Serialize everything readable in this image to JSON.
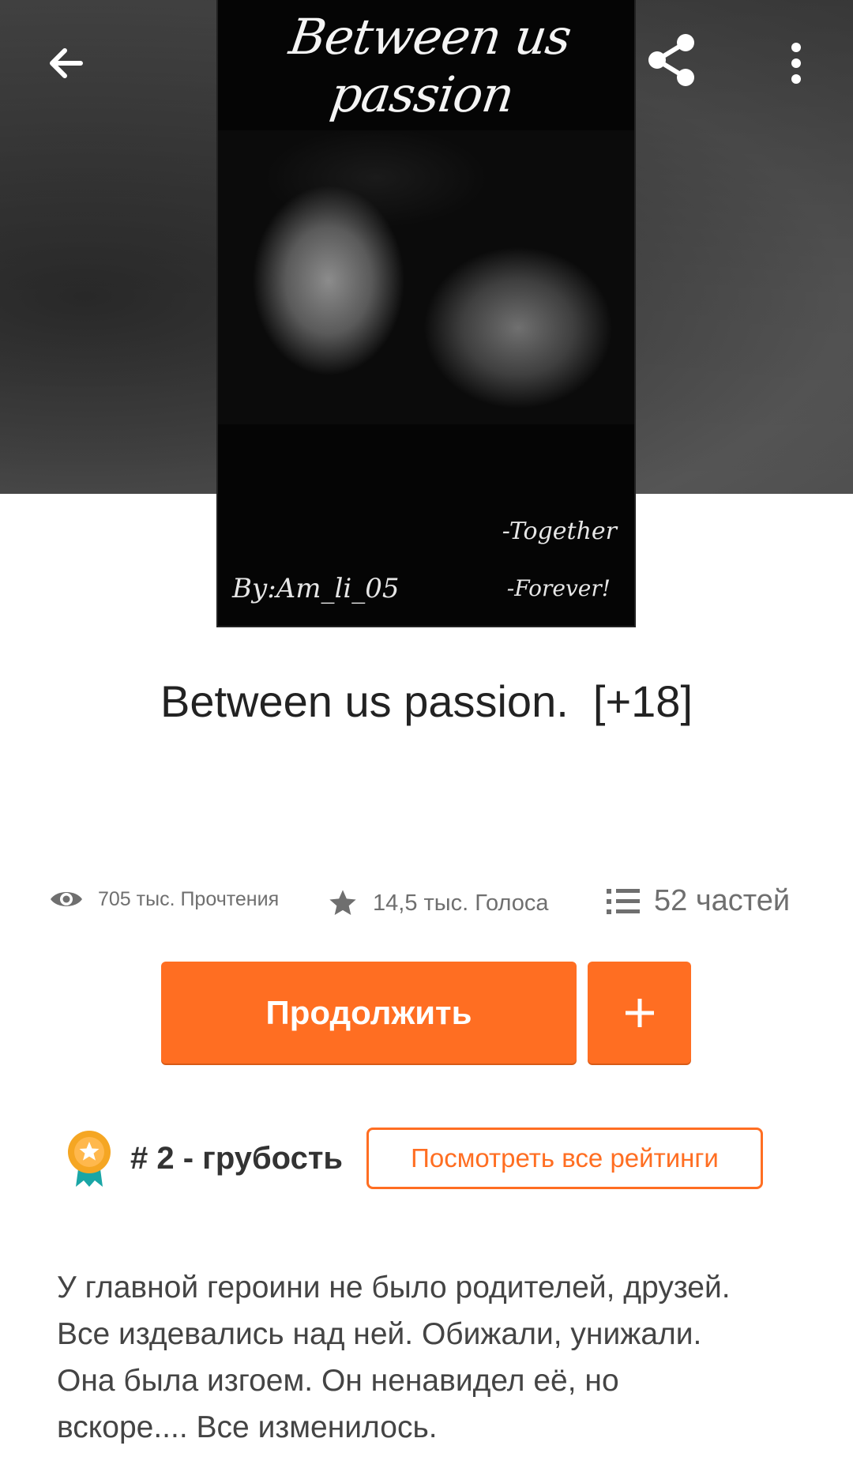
{
  "cover": {
    "title": "Between us passion",
    "byline": "By:Am_li_05",
    "tag1": "-Together",
    "tag2": "-Forever!"
  },
  "story": {
    "title": "Between us passion.  [+18]",
    "stats": {
      "reads": "705 тыс. Прочтения",
      "votes": "14,5 тыс. Голоса",
      "parts": "52 частей"
    },
    "continue_label": "Продолжить",
    "add_label": "+",
    "rank": "# 2 - грубость",
    "rankings_label": "Посмотреть все рейтинги",
    "description": "У главной героини не было родителей, друзей.\nВсе издевались над ней.  Обижали,  унижали.\nОна была изгоем.  Он ненавидел её,  но\nвскоре.... Все изменилось."
  },
  "colors": {
    "accent": "#ff6e22",
    "muted_text": "#6f6f6f"
  },
  "icons": {
    "back": "arrow-left-icon",
    "share": "share-icon",
    "more": "more-vertical-icon",
    "reads": "eye-icon",
    "votes": "star-icon",
    "parts": "list-icon",
    "add": "plus-icon",
    "rank": "medal-icon"
  }
}
